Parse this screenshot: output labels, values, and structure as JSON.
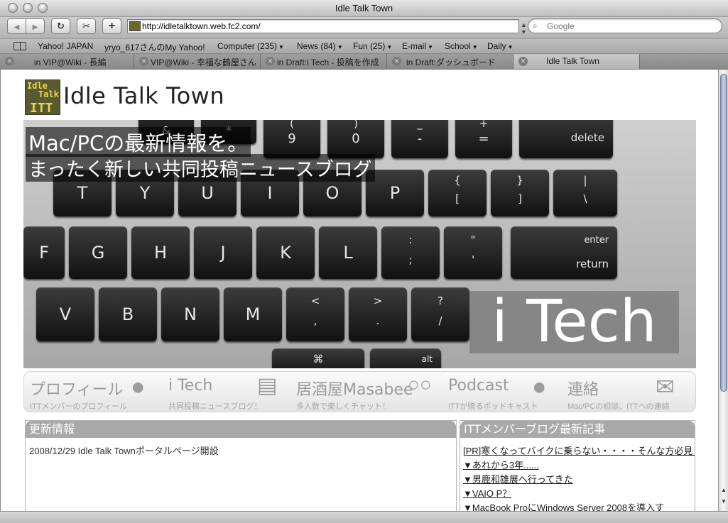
{
  "window": {
    "title": "Idle Talk Town"
  },
  "toolbar": {
    "back": "◀",
    "forward": "▶",
    "reload": "↻",
    "snippet": "✂",
    "add": "+",
    "url": "http://idletalktown.web.fc2.com/",
    "search_placeholder": "Google"
  },
  "bookmarks": [
    {
      "label": "Yahoo! JAPAN",
      "menu": false
    },
    {
      "label": "yryo_617さんのMy Yahoo!",
      "menu": false
    },
    {
      "label": "Computer (235)",
      "menu": true
    },
    {
      "label": "News (84)",
      "menu": true
    },
    {
      "label": "Fun (25)",
      "menu": true
    },
    {
      "label": "E-mail",
      "menu": true
    },
    {
      "label": "School",
      "menu": true
    },
    {
      "label": "Daily",
      "menu": true
    }
  ],
  "tabs": [
    {
      "label": "in VIP@Wiki - 長編",
      "active": false
    },
    {
      "label": "VIP@Wiki - 幸福な鶴屋さん",
      "active": false
    },
    {
      "label": "in Draft:i Tech - 投稿を作成",
      "active": false
    },
    {
      "label": "in Draft:ダッシュボード",
      "active": false
    },
    {
      "label": "Idle Talk Town",
      "active": true
    }
  ],
  "site": {
    "title": "Idle Talk Town",
    "logo_text": [
      "Idle",
      "Talk",
      "ITT"
    ]
  },
  "hero": {
    "line1": "Mac/PCの最新情報を。",
    "line2": "まったく新しい共同投稿ニュースブログ",
    "badge": "i Tech",
    "keys": {
      "row1": [
        "&",
        "*",
        "(",
        ")",
        "_",
        "+",
        "delete"
      ],
      "row1_lower": [
        "7",
        "8",
        "9",
        "0",
        "-",
        "="
      ],
      "row2": [
        "T",
        "Y",
        "U",
        "I",
        "O",
        "P",
        "{",
        "}",
        "|"
      ],
      "row2_lower": [
        "[",
        "]",
        "\\"
      ],
      "row3": [
        "F",
        "G",
        "H",
        "J",
        "K",
        "L",
        ":",
        "\"",
        "enter"
      ],
      "row3_lower": [
        ";",
        "'",
        "return"
      ],
      "row4": [
        "V",
        "B",
        "N",
        "M",
        "<",
        ">",
        "?"
      ],
      "row4_lower": [
        ",",
        ".",
        "/"
      ],
      "row5": [
        "⌘",
        "alt"
      ]
    }
  },
  "nav": [
    {
      "label": "プロフィール",
      "sub": "ITTメンバーのプロフィール",
      "icon": "person-icon"
    },
    {
      "label": "i Tech",
      "sub": "共同投稿ニュースブログ！",
      "icon": "notepad-icon"
    },
    {
      "label": "居酒屋Masabee",
      "sub": "多人数で楽しくチャット！",
      "icon": "chat-bubbles-icon"
    },
    {
      "label": "Podcast",
      "sub": "ITTが贈るポッドキャスト",
      "icon": "headset-person-icon"
    },
    {
      "label": "連絡",
      "sub": "Mac/PCの相談、ITTへの連絡",
      "icon": "envelope-icon"
    }
  ],
  "news": {
    "heading": "更新情報",
    "items": [
      "2008/12/29 Idle Talk Townポータルページ開設"
    ]
  },
  "member_blogs": {
    "heading": "ITTメンバーブログ最新記事",
    "items": [
      "[PR]寒くなってバイクに乗らない・・・・そんな方必見！",
      "▼あれから3年......",
      "▼男鹿和雄展へ行ってきた",
      "▼VAIO P？",
      "▼MacBook ProにWindows Server 2008を導入す"
    ]
  }
}
